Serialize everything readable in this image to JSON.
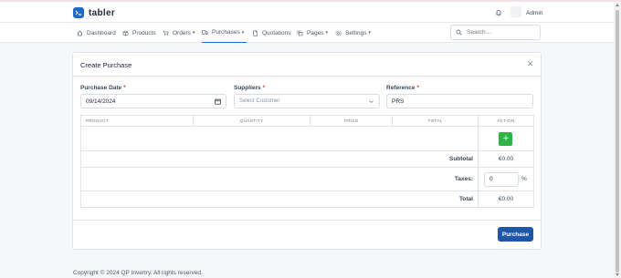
{
  "header": {
    "brand": "tabler",
    "user_name": "Admin"
  },
  "nav": {
    "items": [
      {
        "label": "Dashboard",
        "icon": "home-icon"
      },
      {
        "label": "Products",
        "icon": "package-icon"
      },
      {
        "label": "Orders",
        "icon": "cart-icon",
        "dropdown": true
      },
      {
        "label": "Purchases",
        "icon": "truck-icon",
        "dropdown": true,
        "active": true
      },
      {
        "label": "Quotations",
        "icon": "file-icon"
      },
      {
        "label": "Pages",
        "icon": "copy-icon",
        "dropdown": true
      },
      {
        "label": "Settings",
        "icon": "gear-icon",
        "dropdown": true
      }
    ],
    "search_placeholder": "Search…"
  },
  "card": {
    "title": "Create Purchase",
    "fields": {
      "purchase_date_label": "Purchase Date",
      "purchase_date_value": "09/14/2024",
      "suppliers_label": "Suppliers",
      "suppliers_placeholder": "Select Customer",
      "reference_label": "Reference",
      "reference_value": "PRS",
      "required_mark": "*"
    },
    "table": {
      "headers": [
        "PRODUCT",
        "QUANTITY",
        "PRICE",
        "TOTAL",
        "ACTION"
      ],
      "add_symbol": "+",
      "subtotal_label": "Subtotal",
      "subtotal_value": "€0.00",
      "taxes_label": "Taxes:",
      "taxes_value": "0",
      "taxes_unit": "%",
      "total_label": "Total",
      "total_value": "€0.00"
    },
    "submit_label": "Purchase"
  },
  "footer": {
    "copyright": "Copyright © 2024 QP Invertry. All rights reserved."
  },
  "colors": {
    "primary": "#206bc4",
    "success": "#2fb344",
    "button": "#1f57a8",
    "required": "#d63939"
  }
}
